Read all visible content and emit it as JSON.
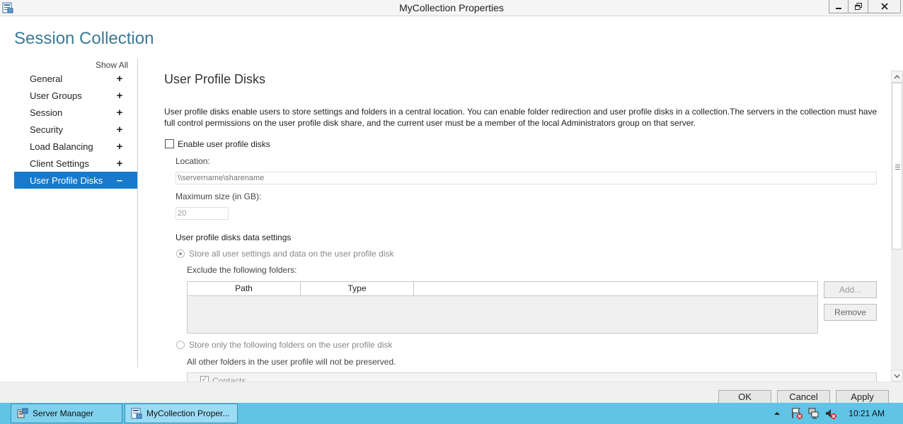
{
  "window": {
    "title": "MyCollection Properties",
    "minimize_icon": "minimize-icon",
    "restore_icon": "restore-icon",
    "close_icon": "close-icon"
  },
  "nav": {
    "header": "Session Collection",
    "show_all": "Show All",
    "items": [
      {
        "label": "General",
        "sign": "+"
      },
      {
        "label": "User Groups",
        "sign": "+"
      },
      {
        "label": "Session",
        "sign": "+"
      },
      {
        "label": "Security",
        "sign": "+"
      },
      {
        "label": "Load Balancing",
        "sign": "+"
      },
      {
        "label": "Client Settings",
        "sign": "+"
      },
      {
        "label": "User Profile Disks",
        "sign": "–"
      }
    ],
    "active_index": 6,
    "accent_color": "#1979ca"
  },
  "main": {
    "title": "User Profile Disks",
    "description": "User profile disks enable users to store settings and folders in a central location. You can enable folder redirection and user profile disks in a collection.The servers in the collection must have full control permissions on the user profile disk share, and the current user must be a member of the local Administrators group on that server.",
    "enable_label": "Enable user profile disks",
    "enable_checked": false,
    "location_label": "Location:",
    "location_placeholder": "\\\\servername\\sharename",
    "max_size_label": "Maximum size (in GB):",
    "max_size_value": "20",
    "data_settings_label": "User profile disks data settings",
    "store_all_label": "Store all user settings and data on the user profile disk",
    "exclude_label": "Exclude the following folders:",
    "table_headers": [
      "Path",
      "Type"
    ],
    "add_button": "Add...",
    "remove_button": "Remove",
    "store_only_label": "Store only the following folders on the user profile disk",
    "not_preserved_label": "All other folders in the user profile will not be preserved.",
    "folder_partial": "Contacts"
  },
  "footer": {
    "ok": "OK",
    "cancel": "Cancel",
    "apply": "Apply"
  },
  "taskbar": {
    "items": [
      {
        "label": "Server Manager",
        "icon": "server-manager-icon"
      },
      {
        "label": "MyCollection Proper...",
        "icon": "properties-window-icon"
      }
    ],
    "time": "10:21 AM"
  }
}
